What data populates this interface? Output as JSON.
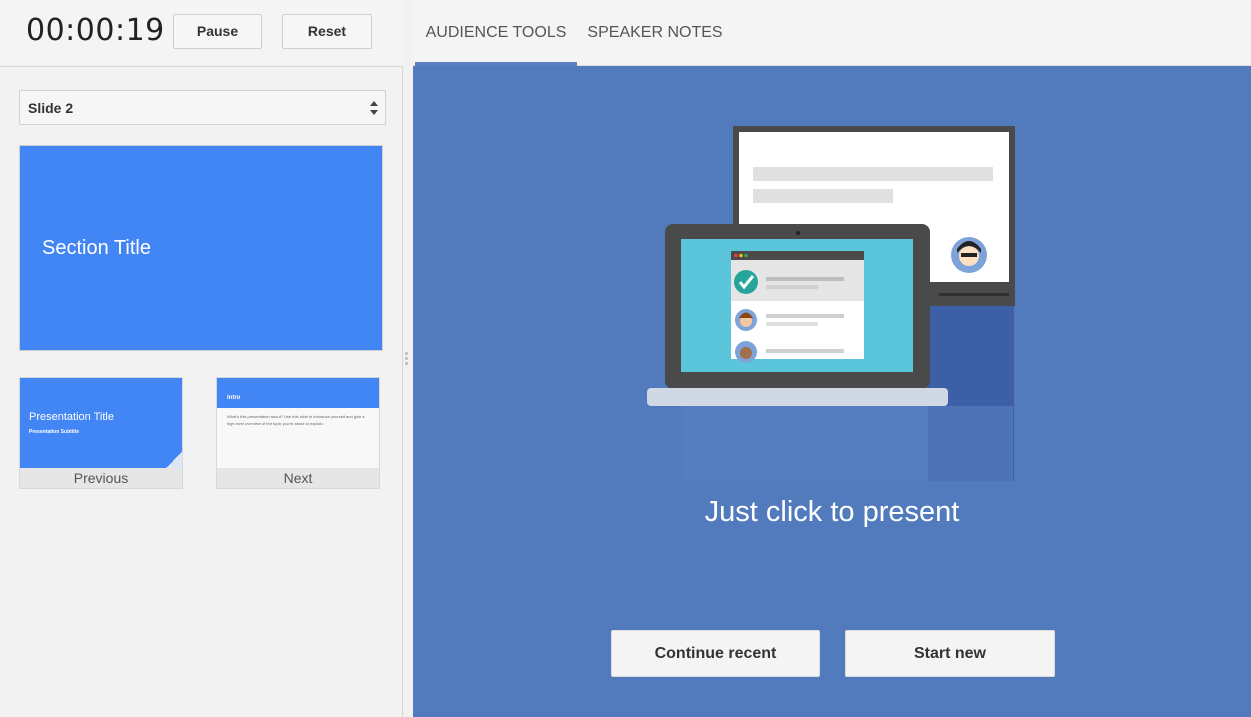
{
  "timer": {
    "value": "00:00:19",
    "pause_label": "Pause",
    "reset_label": "Reset"
  },
  "slide_select": {
    "selected": "Slide 2"
  },
  "current_slide": {
    "title": "Section Title"
  },
  "previous": {
    "label": "Previous",
    "title": "Presentation Title",
    "subtitle": "Presentation Subtitle"
  },
  "next": {
    "label": "Next",
    "title": "Intro",
    "body": "What's this presentation about? Use this slide to introduce yourself and give a high level overview of the topic you're about to explain."
  },
  "tabs": [
    {
      "label": "AUDIENCE TOOLS",
      "active": true
    },
    {
      "label": "SPEAKER NOTES",
      "active": false
    }
  ],
  "stage": {
    "headline": "Just click to present",
    "continue_label": "Continue recent",
    "start_label": "Start new"
  },
  "colors": {
    "slide_blue": "#4285f4",
    "stage_blue": "#527bbd",
    "tab_indicator": "#5b7fbf"
  }
}
